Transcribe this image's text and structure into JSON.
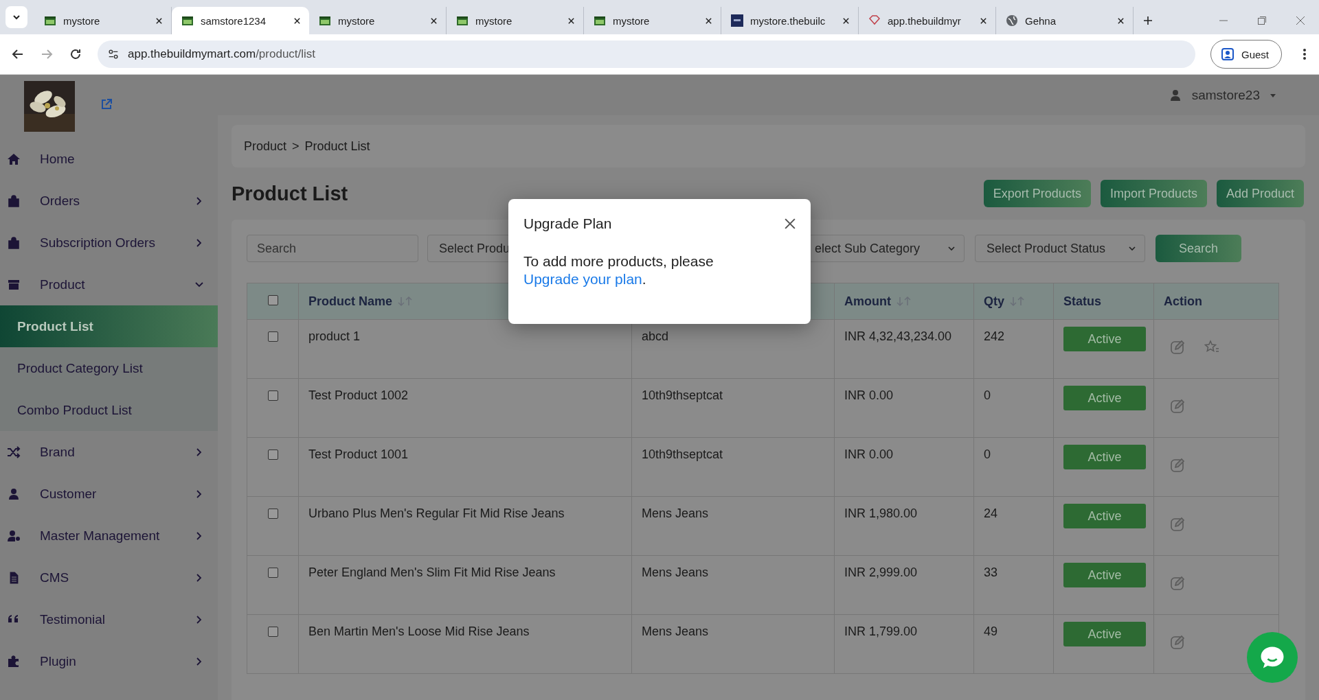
{
  "browser": {
    "tabs": [
      {
        "title": "mystore",
        "selected": false
      },
      {
        "title": "samstore1234",
        "selected": true
      },
      {
        "title": "mystore",
        "selected": false
      },
      {
        "title": "mystore",
        "selected": false
      },
      {
        "title": "mystore",
        "selected": false
      },
      {
        "title": "mystore.thebuilc",
        "selected": false
      },
      {
        "title": "app.thebuildmyr",
        "selected": false
      },
      {
        "title": "Gehna",
        "selected": false
      }
    ],
    "url_host": "app.thebuildmymart.com",
    "url_path": "/product/list",
    "profile": "Guest"
  },
  "header": {
    "user": "samstore23"
  },
  "sidebar": {
    "items": [
      {
        "label": "Home",
        "kind": "link"
      },
      {
        "label": "Orders",
        "kind": "menu",
        "expanded": false
      },
      {
        "label": "Subscription Orders",
        "kind": "menu",
        "expanded": false
      },
      {
        "label": "Product",
        "kind": "menu",
        "expanded": true,
        "children": [
          {
            "label": "Product List",
            "selected": true
          },
          {
            "label": "Product Category List",
            "selected": false
          },
          {
            "label": "Combo Product List",
            "selected": false
          }
        ]
      },
      {
        "label": "Brand",
        "kind": "menu",
        "expanded": false
      },
      {
        "label": "Customer",
        "kind": "menu",
        "expanded": false
      },
      {
        "label": "Master Management",
        "kind": "menu",
        "expanded": false
      },
      {
        "label": "CMS",
        "kind": "menu",
        "expanded": false
      },
      {
        "label": "Testimonial",
        "kind": "menu",
        "expanded": false
      },
      {
        "label": "Plugin",
        "kind": "menu",
        "expanded": false
      }
    ]
  },
  "breadcrumb": {
    "items": [
      "Product",
      "Product List"
    ],
    "separator": ">"
  },
  "page_title": "Product List",
  "actions": [
    "Export Products",
    "Import Products",
    "Add Product"
  ],
  "filters": {
    "search": {
      "placeholder": "Search"
    },
    "selects": [
      "Select Produ",
      "elect Sub Category",
      "Select Product Status"
    ],
    "button": "Search"
  },
  "table": {
    "all_checked": false,
    "columns": [
      {
        "label": "Product Name",
        "sortable": true
      },
      {},
      {
        "label": "Amount",
        "sortable": true
      },
      {
        "label": "Qty",
        "sortable": true
      },
      {
        "label": "Status",
        "sortable": false
      },
      {
        "label": "Action",
        "sortable": false
      }
    ],
    "rows": [
      {
        "checked": false,
        "name": "product 1",
        "column_2": "abcd",
        "amount": "INR 4,32,43,234.00",
        "qty": "242",
        "status": "Active",
        "feature_action": true
      },
      {
        "checked": false,
        "name": "Test Product 1002",
        "column_2": "10th9thseptcat",
        "amount": "INR 0.00",
        "qty": "0",
        "status": "Active",
        "feature_action": false
      },
      {
        "checked": false,
        "name": "Test Product 1001",
        "column_2": "10th9thseptcat",
        "amount": "INR 0.00",
        "qty": "0",
        "status": "Active",
        "feature_action": false
      },
      {
        "checked": false,
        "name": "Urbano Plus Men's Regular Fit Mid Rise Jeans",
        "column_2": "Mens Jeans",
        "amount": "INR 1,980.00",
        "qty": "24",
        "status": "Active",
        "feature_action": false
      },
      {
        "checked": false,
        "name": "Peter England Men's Slim Fit Mid Rise Jeans",
        "column_2": "Mens Jeans",
        "amount": "INR 2,999.00",
        "qty": "33",
        "status": "Active",
        "feature_action": false
      },
      {
        "checked": false,
        "name": "Ben Martin Men's Loose Mid Rise Jeans",
        "column_2": "Mens Jeans",
        "amount": "INR 1,799.00",
        "qty": "49",
        "status": "Active",
        "feature_action": false
      }
    ]
  },
  "modal": {
    "title": "Upgrade Plan",
    "text": "To add more products, please",
    "link": "Upgrade your plan",
    "text_after": "."
  }
}
